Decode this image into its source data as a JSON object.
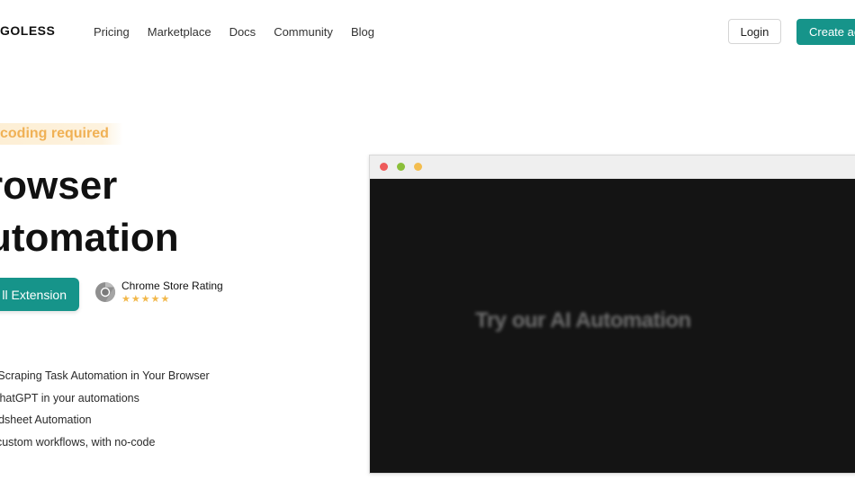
{
  "header": {
    "logo": "GOLESS",
    "nav": [
      "Pricing",
      "Marketplace",
      "Docs",
      "Community",
      "Blog"
    ],
    "login_label": "Login",
    "create_label": "Create ac"
  },
  "hero": {
    "badge": "coding required",
    "title_line1": "rowser",
    "title_line2": "utomation",
    "install_label": "ll Extension",
    "rating_label": "Chrome Store Rating",
    "stars": "★★★★★",
    "features": [
      "eb Scraping Task Automation in Your Browser",
      "e ChatGPT in your automations",
      "readsheet Automation",
      "ild custom workflows, with no-code"
    ]
  },
  "video": {
    "text": "Try our AI Automation"
  },
  "colors": {
    "accent": "#16948a",
    "badge_text": "#f0b155",
    "star": "#f2b84b"
  }
}
